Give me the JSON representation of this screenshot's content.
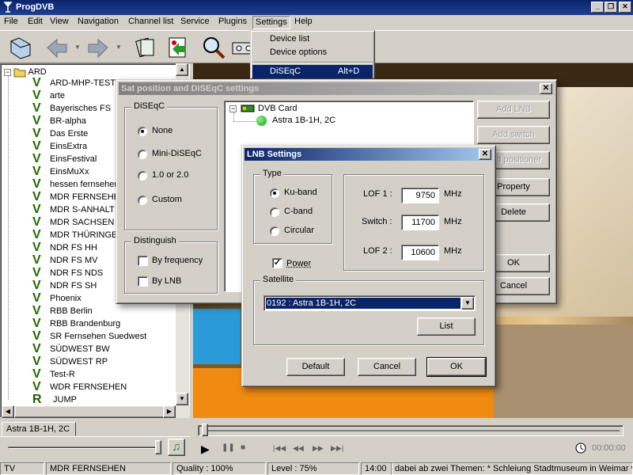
{
  "app": {
    "title": "ProgDVB"
  },
  "menubar": [
    "File",
    "Edit",
    "View",
    "Navigation",
    "Channel list",
    "Service",
    "Plugins",
    "Settings",
    "Help"
  ],
  "settings_menu": {
    "items": [
      {
        "label": "Device list",
        "shortcut": ""
      },
      {
        "label": "Device options",
        "shortcut": ""
      },
      {
        "label": "DiSEqC",
        "shortcut": "Alt+D"
      }
    ]
  },
  "tree": {
    "root": "ARD",
    "channels": [
      "ARD-MHP-TEST-",
      "arte",
      "Bayerisches FS",
      "BR-alpha",
      "Das Erste",
      "EinsExtra",
      "EinsFestival",
      "EinsMuXx",
      "hessen fernsehen",
      "MDR FERNSEHEN",
      "MDR S-ANHALT",
      "MDR SACHSEN",
      "MDR THÜRINGEN",
      "NDR FS HH",
      "NDR FS MV",
      "NDR FS NDS",
      "NDR FS SH",
      "Phoenix",
      "RBB Berlin",
      "RBB Brandenburg",
      "SR Fernsehen Suedwest",
      "SÜDWEST BW",
      "SÜDWEST RP",
      "Test-R",
      "WDR FERNSEHEN"
    ],
    "last": {
      "icon": "R",
      "label": "JUMP"
    }
  },
  "left_tab": "Astra 1B-1H, 2C",
  "sat_dialog": {
    "title": "Sat position and DiSEqC settings",
    "diseqc_group": "DiSEqC",
    "diseqc_options": [
      "None",
      "Mini-DiSEqC",
      "1.0 or 2.0",
      "Custom"
    ],
    "diseqc_selected": 0,
    "distinguish_group": "Distinguish",
    "distinguish_options": [
      "By frequency",
      "By LNB"
    ],
    "tree_root": "DVB Card",
    "tree_child": "Astra 1B-1H, 2C",
    "buttons": [
      "Add LNB",
      "Add switch",
      "Add positioner",
      "Property",
      "Delete",
      "OK",
      "Cancel"
    ]
  },
  "lnb_dialog": {
    "title": "LNB Settings",
    "type_group": "Type",
    "types": [
      "Ku-band",
      "C-band",
      "Circular"
    ],
    "type_selected": 0,
    "power_label": "Power",
    "power_checked": true,
    "lof1_label": "LOF 1 :",
    "lof1": "9750",
    "switch_label": "Switch :",
    "switch": "11700",
    "lof2_label": "LOF 2 :",
    "lof2": "10600",
    "unit": "MHz",
    "satellite_group": "Satellite",
    "satellite_value": "0192 : Astra 1B-1H, 2C",
    "list_button": "List",
    "default_button": "Default",
    "cancel_button": "Cancel",
    "ok_button": "OK"
  },
  "player": {
    "time": "00:00:00"
  },
  "status": {
    "mode": "TV",
    "channel": "MDR FERNSEHEN",
    "quality": "Quality : 100%",
    "level": "Level : 75%",
    "time": "14:00",
    "epg": "dabei ab zwei  Themen: * Schleiung Stadtmuseum in Weimar vo"
  },
  "colors": {
    "title_active": "#0a246a",
    "selection": "#0a246a",
    "face": "#d4d0c8",
    "channel_icon": "#1e6b00"
  }
}
